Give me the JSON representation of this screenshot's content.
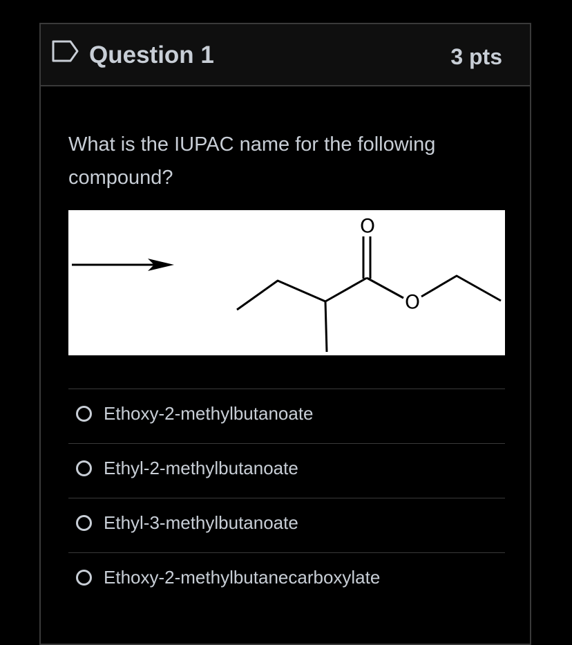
{
  "question": {
    "title": "Question 1",
    "points": "3 pts",
    "prompt": "What is the IUPAC name for the following compound?"
  },
  "figure": {
    "atom_label_o1": "O",
    "atom_label_o2": "O"
  },
  "answers": [
    {
      "label": "Ethoxy-2-methylbutanoate",
      "selected": false
    },
    {
      "label": "Ethyl-2-methylbutanoate",
      "selected": false
    },
    {
      "label": "Ethyl-3-methylbutanoate",
      "selected": false
    },
    {
      "label": "Ethoxy-2-methylbutanecarboxylate",
      "selected": false
    }
  ],
  "colors": {
    "background": "#000000",
    "header_bg": "#0f0f0f",
    "border": "#3a3a3a",
    "text": "#c8ced6"
  }
}
